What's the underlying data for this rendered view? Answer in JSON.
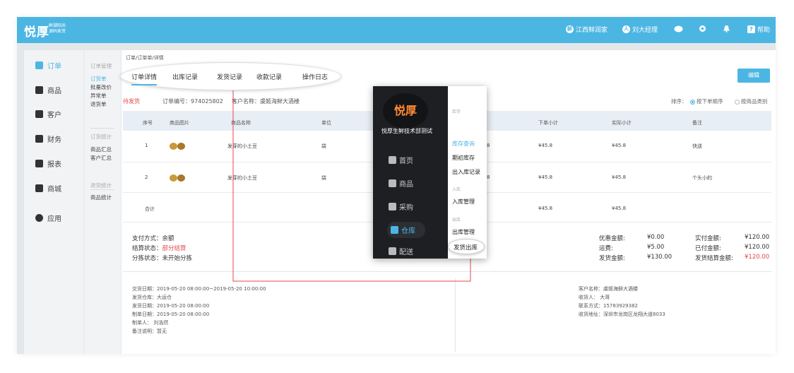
{
  "topbar": {
    "logo": "悦厚",
    "slogan_line1": "鲜潮陪尚",
    "slogan_line2": "源码家资",
    "store": "江西鲜润家",
    "user": "刘大经理",
    "help": "帮助"
  },
  "sidebar1": {
    "items": [
      {
        "label": "订单",
        "icon": "order-icon"
      },
      {
        "label": "商品",
        "icon": "goods-icon"
      },
      {
        "label": "客户",
        "icon": "customer-icon"
      },
      {
        "label": "财务",
        "icon": "finance-icon"
      },
      {
        "label": "报表",
        "icon": "report-icon"
      },
      {
        "label": "商城",
        "icon": "mall-icon"
      },
      {
        "label": "应用",
        "icon": "app-icon"
      }
    ]
  },
  "sidebar2": {
    "group1_head": "订单管理",
    "group1": [
      "订货单",
      "批量改价",
      "异常单",
      "退货单"
    ],
    "group2_head": "订货统计",
    "group2": [
      "商品汇总",
      "客户汇总"
    ],
    "group3_head": "退货统计",
    "group3": [
      "商品统计"
    ]
  },
  "main": {
    "breadcrumb": "订单/订单单/详情",
    "tabs": [
      "订单详情",
      "出库记录",
      "发货记录",
      "收款记录",
      "操作日志"
    ],
    "edit_label": "编辑",
    "status": "待发货",
    "order_no": "订单编号：974025802",
    "customer": "客户名称：虞姬海鲜大酒楼",
    "sort_label": "排序：",
    "sort_opt1": "按下单顺序",
    "sort_opt2": "按商品类别",
    "table": {
      "headers": [
        "序号",
        "商品图片",
        "商品名称",
        "单位",
        "下单小计",
        "实际小计",
        "备注"
      ],
      "rows": [
        {
          "no": "1",
          "name": "发芽的小土豆",
          "unit": "袋",
          "partial": "8",
          "order_sub": "¥45.8",
          "actual_sub": "¥45.8",
          "note": "快送"
        },
        {
          "no": "2",
          "name": "发芽的小土豆",
          "unit": "袋",
          "partial": "8",
          "order_sub": "¥45.8",
          "actual_sub": "¥45.8",
          "note": "个头小的"
        }
      ],
      "total_label": "合计",
      "total_order": "¥45.8",
      "total_actual": "¥45.8"
    },
    "summary": {
      "pay_label": "支付方式：",
      "pay_value": "余额",
      "settle_label": "结算状态：",
      "settle_value": "部分结算",
      "sort_state_label": "分拣状态：",
      "sort_state_value": "未开始分拣",
      "discount_label": "优惠金额:",
      "discount": "¥0.00",
      "freight_label": "运费:",
      "freight": "¥5.00",
      "ship_amt_label": "发货金额:",
      "ship_amt": "¥130.00",
      "paid_label": "实付金额:",
      "paid": "¥120.00",
      "already_label": "已付金额:",
      "already": "¥120.00",
      "final_label": "发货结算金额:",
      "final": "¥120.00"
    },
    "details_left": [
      "交货日期：2019-05-20 08:00:00~2019-05-20 10:00:00",
      "发货仓库：大运仓",
      "发货日期：2019-05-20 08:00:00",
      "制单日期：2019-05-20 08:00:00",
      "制单人：  刘浩然",
      "备注说明：暂无"
    ],
    "details_right": [
      "客户名称：虞姬海鲜大酒楼",
      "收货人：  大哥",
      "联系方式：15783929382",
      "收货地址：深圳市龙岗区龙翔大道8033"
    ]
  },
  "popup": {
    "logo": "悦厚",
    "company": "悦厚生鲜技术部测试",
    "nav": [
      "首页",
      "商品",
      "采购",
      "仓库",
      "配送"
    ],
    "sub_head1": "库存",
    "sub1": [
      "库存查询",
      "期初库存",
      "出入库记录"
    ],
    "sub_head2": "入库",
    "sub2": [
      "入库管理"
    ],
    "sub_head3": "出库",
    "sub3": [
      "出库管理",
      "发货出库"
    ]
  },
  "colors": {
    "accent": "#4cb6e3",
    "danger": "#e8474a",
    "popup_bg": "#1e1f22"
  }
}
